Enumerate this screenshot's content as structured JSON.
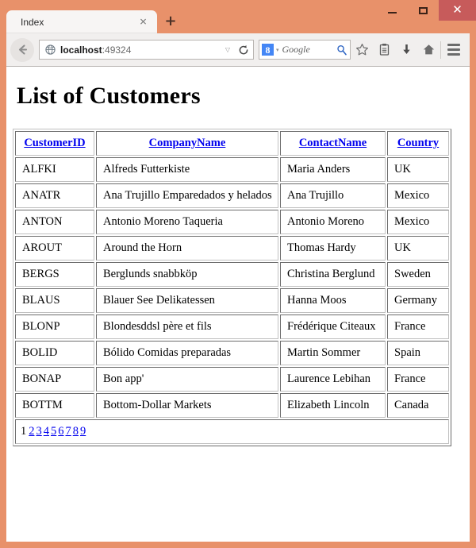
{
  "window": {
    "chrome_color": "#e8916a",
    "close_button_color": "#c75b5b",
    "minimize_label": "–",
    "maximize_label": "□",
    "close_label": "✕"
  },
  "tabs": {
    "active_tab_label": "Index",
    "close_tab_label": "✕",
    "new_tab_label": "+"
  },
  "toolbar": {
    "back_icon": "back-arrow-icon",
    "url_host": "localhost",
    "url_rest": ":49324",
    "url_dropdown_label": "▽",
    "reload_label": "↻",
    "search_engine_glyph": "8",
    "search_engine_dropdown_label": "▾",
    "search_placeholder": "Google",
    "search_go_icon": "magnifier-icon",
    "bookmark_icon": "star-icon",
    "reading_list_icon": "clipboard-icon",
    "downloads_icon": "download-arrow-icon",
    "home_icon": "home-icon",
    "menu_icon": "hamburger-menu-icon"
  },
  "page": {
    "heading": "List of Customers",
    "table": {
      "headers": [
        "CustomerID",
        "CompanyName",
        "ContactName",
        "Country"
      ],
      "rows": [
        [
          "ALFKI",
          "Alfreds Futterkiste",
          "Maria Anders",
          "UK"
        ],
        [
          "ANATR",
          "Ana Trujillo Emparedados y helados",
          "Ana Trujillo",
          "Mexico"
        ],
        [
          "ANTON",
          "Antonio Moreno Taqueria",
          "Antonio Moreno",
          "Mexico"
        ],
        [
          "AROUT",
          "Around the Horn",
          "Thomas Hardy",
          "UK"
        ],
        [
          "BERGS",
          "Berglunds snabbköp",
          "Christina Berglund",
          "Sweden"
        ],
        [
          "BLAUS",
          "Blauer See Delikatessen",
          "Hanna Moos",
          "Germany"
        ],
        [
          "BLONP",
          "Blondesddsl père et fils",
          "Frédérique Citeaux",
          "France"
        ],
        [
          "BOLID",
          "Bólido Comidas preparadas",
          "Martin Sommer",
          "Spain"
        ],
        [
          "BONAP",
          "Bon app'",
          "Laurence Lebihan",
          "France"
        ],
        [
          "BOTTM",
          "Bottom-Dollar Markets",
          "Elizabeth Lincoln",
          "Canada"
        ]
      ]
    },
    "pagination": {
      "current": "1",
      "links": [
        "2",
        "3",
        "4",
        "5",
        "6",
        "7",
        "8",
        "9"
      ]
    },
    "link_color": "#0000ee"
  }
}
